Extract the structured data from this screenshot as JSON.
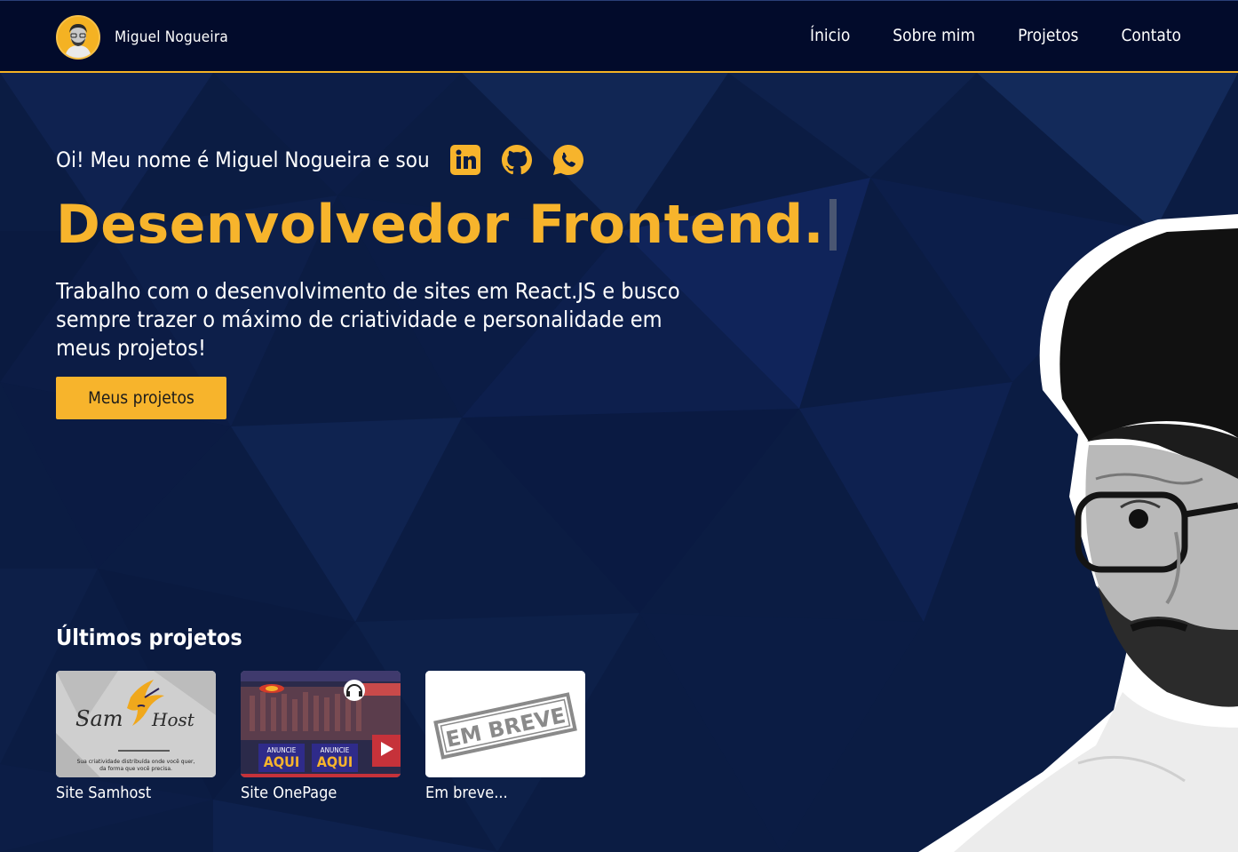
{
  "header": {
    "brand_name": "Miguel Nogueira",
    "nav": [
      "Ínicio",
      "Sobre mim",
      "Projetos",
      "Contato"
    ]
  },
  "hero": {
    "greeting": "Oi! Meu nome é Miguel Nogueira e sou",
    "socials": [
      {
        "name": "linkedin-icon"
      },
      {
        "name": "github-icon"
      },
      {
        "name": "whatsapp-icon"
      }
    ],
    "headline": "Desenvolvedor Frontend.",
    "description": "Trabalho com o desenvolvimento de sites em React.JS e busco sempre trazer o máximo de criatividade e personalidade em meus projetos!",
    "cta_label": "Meus projetos"
  },
  "projects": {
    "title": "Últimos projetos",
    "items": [
      {
        "label": "Site Samhost",
        "logo_left": "Sam",
        "logo_right": "Host",
        "tagline_1": "Sua criatividade distribuída onde você quer,",
        "tagline_2": "da forma que você precisa."
      },
      {
        "label": "Site OnePage",
        "ad_top": "ANUNCIE",
        "ad_bottom": "AQUI"
      },
      {
        "label": "Em breve...",
        "stamp": "EM BREVE"
      }
    ]
  },
  "colors": {
    "accent": "#f7b42c",
    "header_bg": "#020b2b",
    "page_bg": "#0a1a3f"
  }
}
